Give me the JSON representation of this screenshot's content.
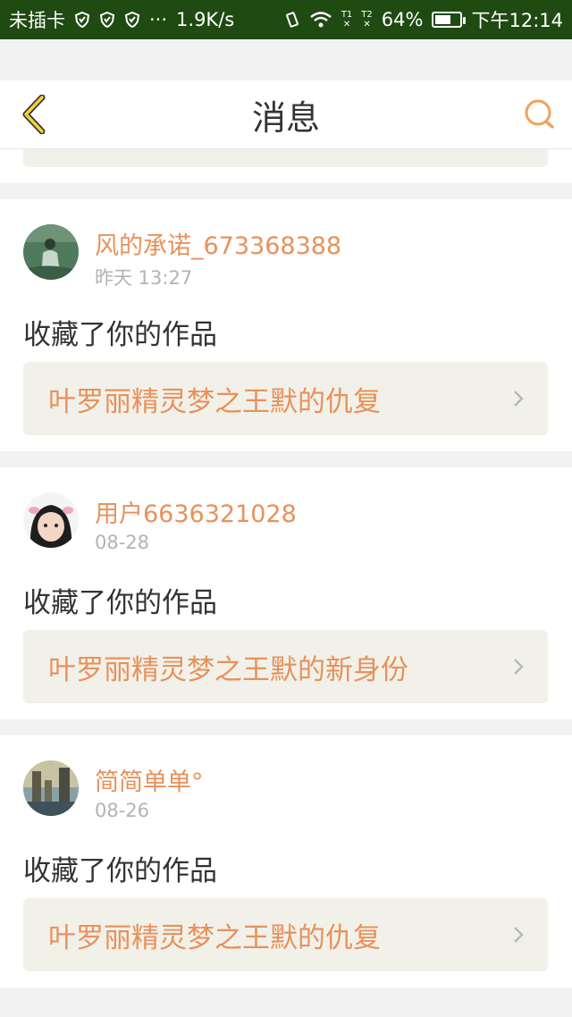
{
  "status_bar": {
    "carrier": "未插卡",
    "dots": "···",
    "speed": "1.9K/s",
    "sim1": "T1",
    "sim2": "T2",
    "battery_percent": "64%",
    "battery_level": 0.64,
    "time": "下午12:14"
  },
  "header": {
    "title": "消息",
    "back_icon": "chevron-left-icon",
    "search_icon": "search-icon"
  },
  "colors": {
    "status_bar_bg": "#1f4a12",
    "accent_orange": "#e8915a",
    "back_icon_yellow": "#f3d03a",
    "box_bg": "#f1f1ea"
  },
  "messages": [
    {
      "username": "风的承诺_673368388",
      "time": "昨天 13:27",
      "action": "收藏了你的作品",
      "work_title": "叶罗丽精灵梦之王默的仇复"
    },
    {
      "username": "用户6636321028",
      "time": "08-28",
      "action": "收藏了你的作品",
      "work_title": "叶罗丽精灵梦之王默的新身份"
    },
    {
      "username": "简简单单°",
      "time": "08-26",
      "action": "收藏了你的作品",
      "work_title": "叶罗丽精灵梦之王默的仇复"
    }
  ]
}
